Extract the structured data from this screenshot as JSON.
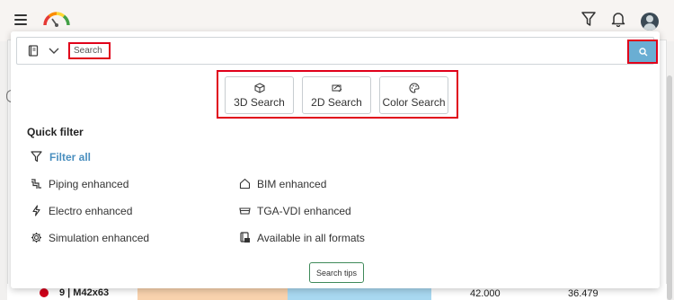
{
  "app": {
    "menu_icon": "hamburger-icon",
    "logo_icon": "gauge-logo-icon",
    "header_icons": [
      "filter-icon",
      "bell-icon",
      "user-avatar"
    ]
  },
  "search": {
    "type_icon": "catalog-book-icon",
    "placeholder": "Search",
    "submit_icon": "magnifier-icon"
  },
  "search_modes": [
    {
      "label": "3D Search",
      "icon": "cube-icon"
    },
    {
      "label": "2D Search",
      "icon": "drawing-icon"
    },
    {
      "label": "Color Search",
      "icon": "palette-icon"
    }
  ],
  "quick_filter": {
    "title": "Quick filter",
    "filter_all": "Filter all",
    "items_left": [
      {
        "label": "Piping enhanced",
        "icon": "piping-icon"
      },
      {
        "label": "Electro enhanced",
        "icon": "lightning-icon"
      },
      {
        "label": "Simulation enhanced",
        "icon": "gear-icon"
      }
    ],
    "items_right": [
      {
        "label": "BIM enhanced",
        "icon": "house-icon"
      },
      {
        "label": "TGA-VDI enhanced",
        "icon": "duct-icon"
      },
      {
        "label": "Available in all formats",
        "icon": "formats-icon"
      }
    ]
  },
  "search_tips": "Search tips",
  "background_row": {
    "name": "9 | M42x63",
    "value_1": "42.000",
    "value_2": "36.479",
    "status_color": "#d0021b"
  },
  "colors": {
    "accent": "#6aaed3",
    "highlight": "#e0001a",
    "link": "#4a8fbf"
  }
}
